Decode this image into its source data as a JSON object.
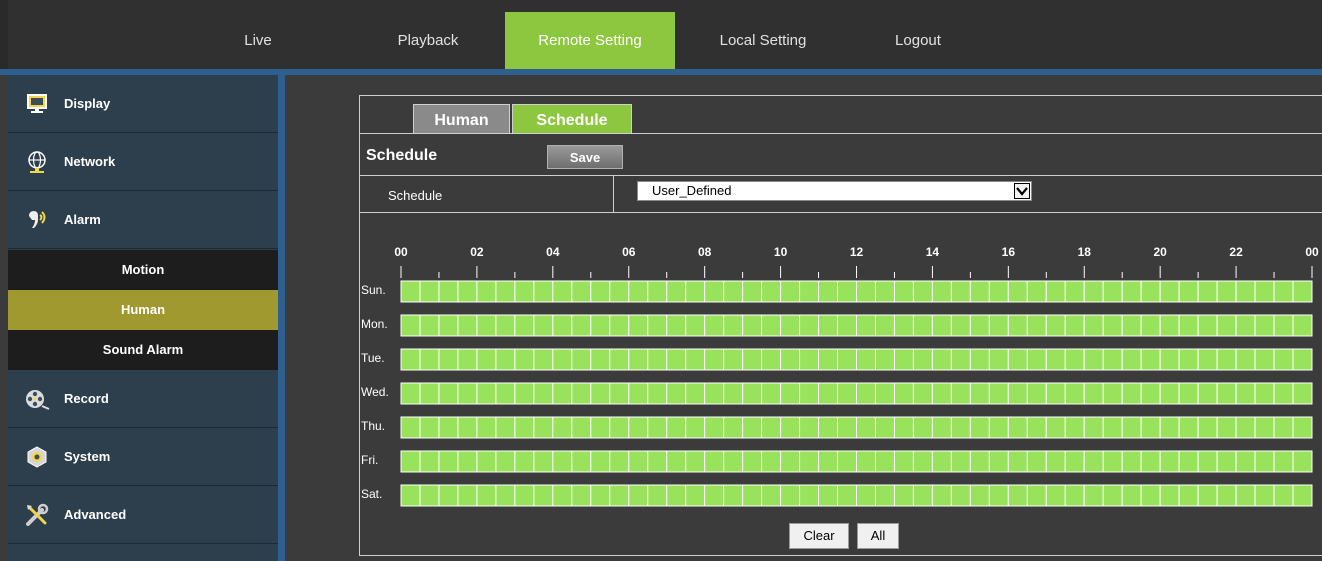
{
  "nav": {
    "tabs": [
      {
        "label": "Live",
        "active": false
      },
      {
        "label": "Playback",
        "active": false
      },
      {
        "label": "Remote Setting",
        "active": true
      },
      {
        "label": "Local Setting",
        "active": false
      },
      {
        "label": "Logout",
        "active": false
      }
    ]
  },
  "sidebar": {
    "items": [
      {
        "label": "Display",
        "icon": "monitor-icon"
      },
      {
        "label": "Network",
        "icon": "globe-icon"
      },
      {
        "label": "Alarm",
        "icon": "alarm-icon"
      },
      {
        "label": "Record",
        "icon": "film-reel-icon"
      },
      {
        "label": "System",
        "icon": "nut-icon"
      },
      {
        "label": "Advanced",
        "icon": "tools-icon"
      }
    ],
    "alarm_subitems": [
      {
        "label": "Motion",
        "active": false
      },
      {
        "label": "Human",
        "active": true
      },
      {
        "label": "Sound Alarm",
        "active": false
      }
    ]
  },
  "content": {
    "subtabs": [
      {
        "label": "Human",
        "active": false
      },
      {
        "label": "Schedule",
        "active": true
      }
    ],
    "section_title": "Schedule",
    "save_label": "Save",
    "schedule_label": "Schedule",
    "schedule_value": "User_Defined",
    "hours": [
      "00",
      "02",
      "04",
      "06",
      "08",
      "10",
      "12",
      "14",
      "16",
      "18",
      "20",
      "22",
      "00"
    ],
    "days": [
      "Sun.",
      "Mon.",
      "Tue.",
      "Wed.",
      "Thu.",
      "Fri.",
      "Sat."
    ],
    "slots_per_day": 48,
    "all_slots_enabled": true,
    "clear_label": "Clear",
    "all_label": "All"
  },
  "colors": {
    "accent_green": "#8dc63f",
    "slot_green": "#99e35c",
    "sidebar_bg": "#2d3e4c",
    "active_subitem": "#a0992f",
    "blue_stripe": "#2f5f8f"
  }
}
